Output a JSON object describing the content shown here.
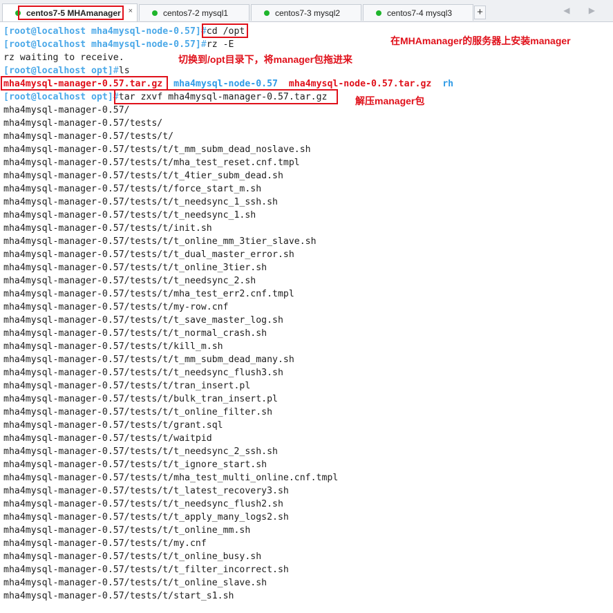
{
  "tabs": [
    {
      "label": "centos7-5 MHAmanager",
      "active": true
    },
    {
      "label": "centos7-2 mysql1",
      "active": false
    },
    {
      "label": "centos7-3 mysql2",
      "active": false
    },
    {
      "label": "centos7-4 mysql3",
      "active": false
    }
  ],
  "tab_close_glyph": "×",
  "add_tab_glyph": "+",
  "nav_arrows": "◀ ▶",
  "terminal": {
    "cmd1": {
      "prompt": "[root@localhost mha4mysql-node-0.57]",
      "hash": "#",
      "text": "cd /opt"
    },
    "cmd2": {
      "prompt": "[root@localhost mha4mysql-node-0.57]",
      "hash": "#",
      "text": "rz -E"
    },
    "rz_output": "rz waiting to receive.",
    "cmd3": {
      "prompt": "[root@localhost opt]",
      "hash": "#",
      "text": "ls"
    },
    "ls_output": {
      "manager_tar": "mha4mysql-manager-0.57.tar.gz",
      "node_dir": "mha4mysql-node-0.57",
      "node_tar": "mha4mysql-node-0.57.tar.gz",
      "rh": "rh"
    },
    "cmd4": {
      "prompt": "[root@localhost opt]",
      "hash": "#",
      "text": "tar zxvf mha4mysql-manager-0.57.tar.gz"
    },
    "tar_output": [
      "mha4mysql-manager-0.57/",
      "mha4mysql-manager-0.57/tests/",
      "mha4mysql-manager-0.57/tests/t/",
      "mha4mysql-manager-0.57/tests/t/t_mm_subm_dead_noslave.sh",
      "mha4mysql-manager-0.57/tests/t/mha_test_reset.cnf.tmpl",
      "mha4mysql-manager-0.57/tests/t/t_4tier_subm_dead.sh",
      "mha4mysql-manager-0.57/tests/t/force_start_m.sh",
      "mha4mysql-manager-0.57/tests/t/t_needsync_1_ssh.sh",
      "mha4mysql-manager-0.57/tests/t/t_needsync_1.sh",
      "mha4mysql-manager-0.57/tests/t/init.sh",
      "mha4mysql-manager-0.57/tests/t/t_online_mm_3tier_slave.sh",
      "mha4mysql-manager-0.57/tests/t/t_dual_master_error.sh",
      "mha4mysql-manager-0.57/tests/t/t_online_3tier.sh",
      "mha4mysql-manager-0.57/tests/t/t_needsync_2.sh",
      "mha4mysql-manager-0.57/tests/t/mha_test_err2.cnf.tmpl",
      "mha4mysql-manager-0.57/tests/t/my-row.cnf",
      "mha4mysql-manager-0.57/tests/t/t_save_master_log.sh",
      "mha4mysql-manager-0.57/tests/t/t_normal_crash.sh",
      "mha4mysql-manager-0.57/tests/t/kill_m.sh",
      "mha4mysql-manager-0.57/tests/t/t_mm_subm_dead_many.sh",
      "mha4mysql-manager-0.57/tests/t/t_needsync_flush3.sh",
      "mha4mysql-manager-0.57/tests/t/tran_insert.pl",
      "mha4mysql-manager-0.57/tests/t/bulk_tran_insert.pl",
      "mha4mysql-manager-0.57/tests/t/t_online_filter.sh",
      "mha4mysql-manager-0.57/tests/t/grant.sql",
      "mha4mysql-manager-0.57/tests/t/waitpid",
      "mha4mysql-manager-0.57/tests/t/t_needsync_2_ssh.sh",
      "mha4mysql-manager-0.57/tests/t/t_ignore_start.sh",
      "mha4mysql-manager-0.57/tests/t/mha_test_multi_online.cnf.tmpl",
      "mha4mysql-manager-0.57/tests/t/t_latest_recovery3.sh",
      "mha4mysql-manager-0.57/tests/t/t_needsync_flush2.sh",
      "mha4mysql-manager-0.57/tests/t/t_apply_many_logs2.sh",
      "mha4mysql-manager-0.57/tests/t/t_online_mm.sh",
      "mha4mysql-manager-0.57/tests/t/my.cnf",
      "mha4mysql-manager-0.57/tests/t/t_online_busy.sh",
      "mha4mysql-manager-0.57/tests/t/t_filter_incorrect.sh",
      "mha4mysql-manager-0.57/tests/t/t_online_slave.sh",
      "mha4mysql-manager-0.57/tests/t/start_s1.sh"
    ]
  },
  "annotations": {
    "install_note": "在MHAmanager的服务器上安装manager",
    "upload_note": "切换到/opt目录下，将manager包拖进来",
    "extract_note": "解压manager包"
  },
  "colors": {
    "prompt": "#4aa8e8",
    "highlight_red": "#e0101a",
    "dir_blue": "#2f9be6",
    "tab_dot_green": "#1fb52c"
  }
}
